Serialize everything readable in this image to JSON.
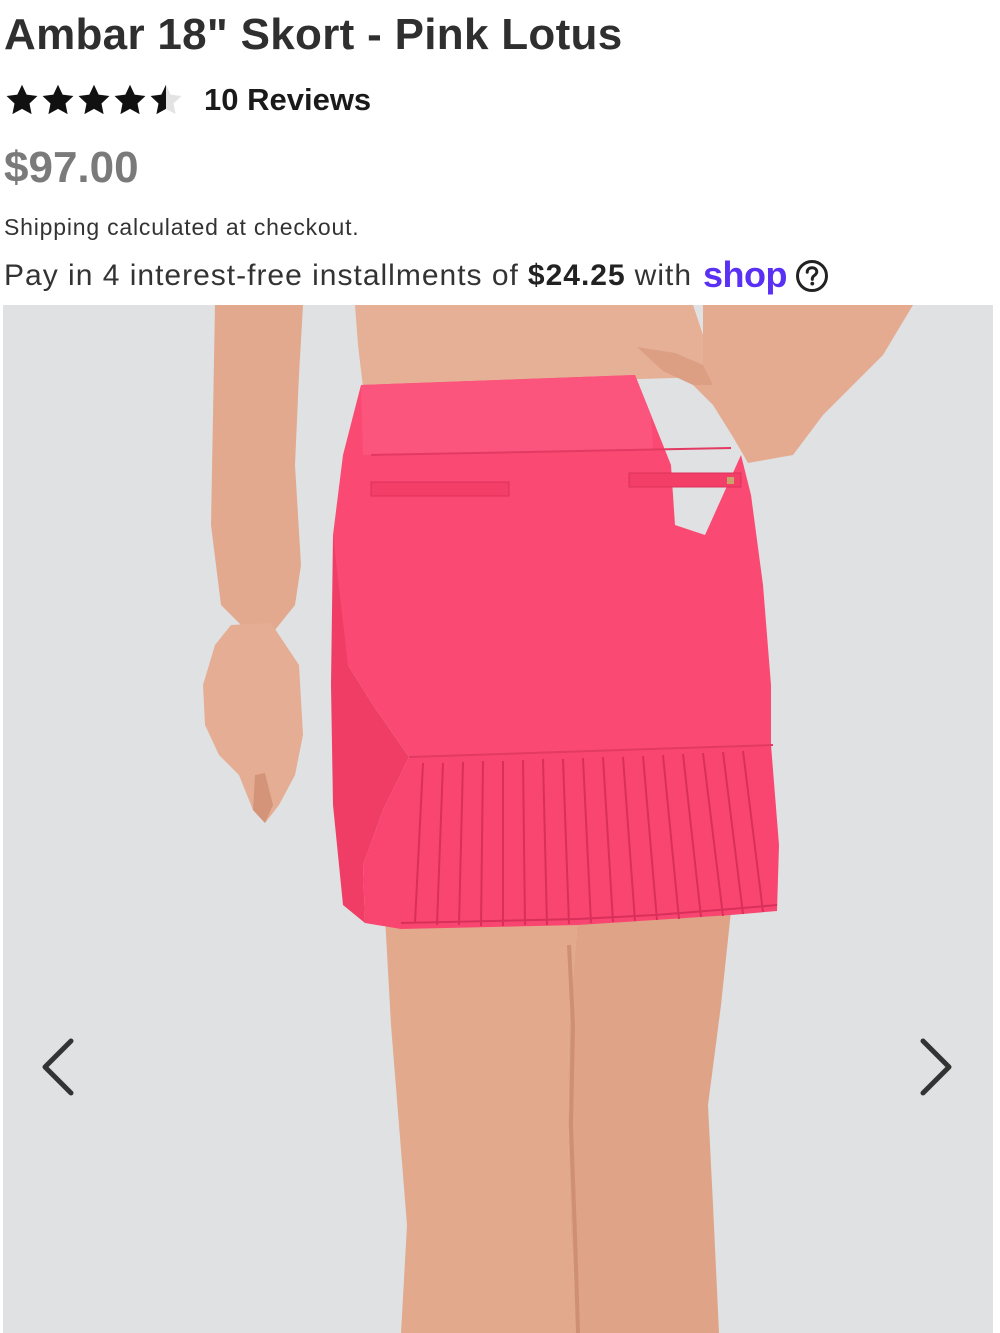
{
  "product": {
    "title": "Ambar 18\" Skort - Pink Lotus",
    "rating": 4.5,
    "rating_max": 5,
    "reviews_label": "10 Reviews",
    "price": "$97.00",
    "shipping_link": "Shipping",
    "shipping_rest": " calculated at checkout."
  },
  "installments": {
    "prefix": "Pay in 4 interest-free installments of",
    "amount": "$24.25",
    "suffix": "with",
    "provider": "shop"
  },
  "carousel": {
    "prev_icon": "chevron-left-icon",
    "next_icon": "chevron-right-icon"
  },
  "colors": {
    "title": "#2f2f2f",
    "price": "#7a7a7a",
    "shop_brand": "#5a31f4",
    "photo_background": "#dfe1e3",
    "skort": "#fa4a73"
  }
}
